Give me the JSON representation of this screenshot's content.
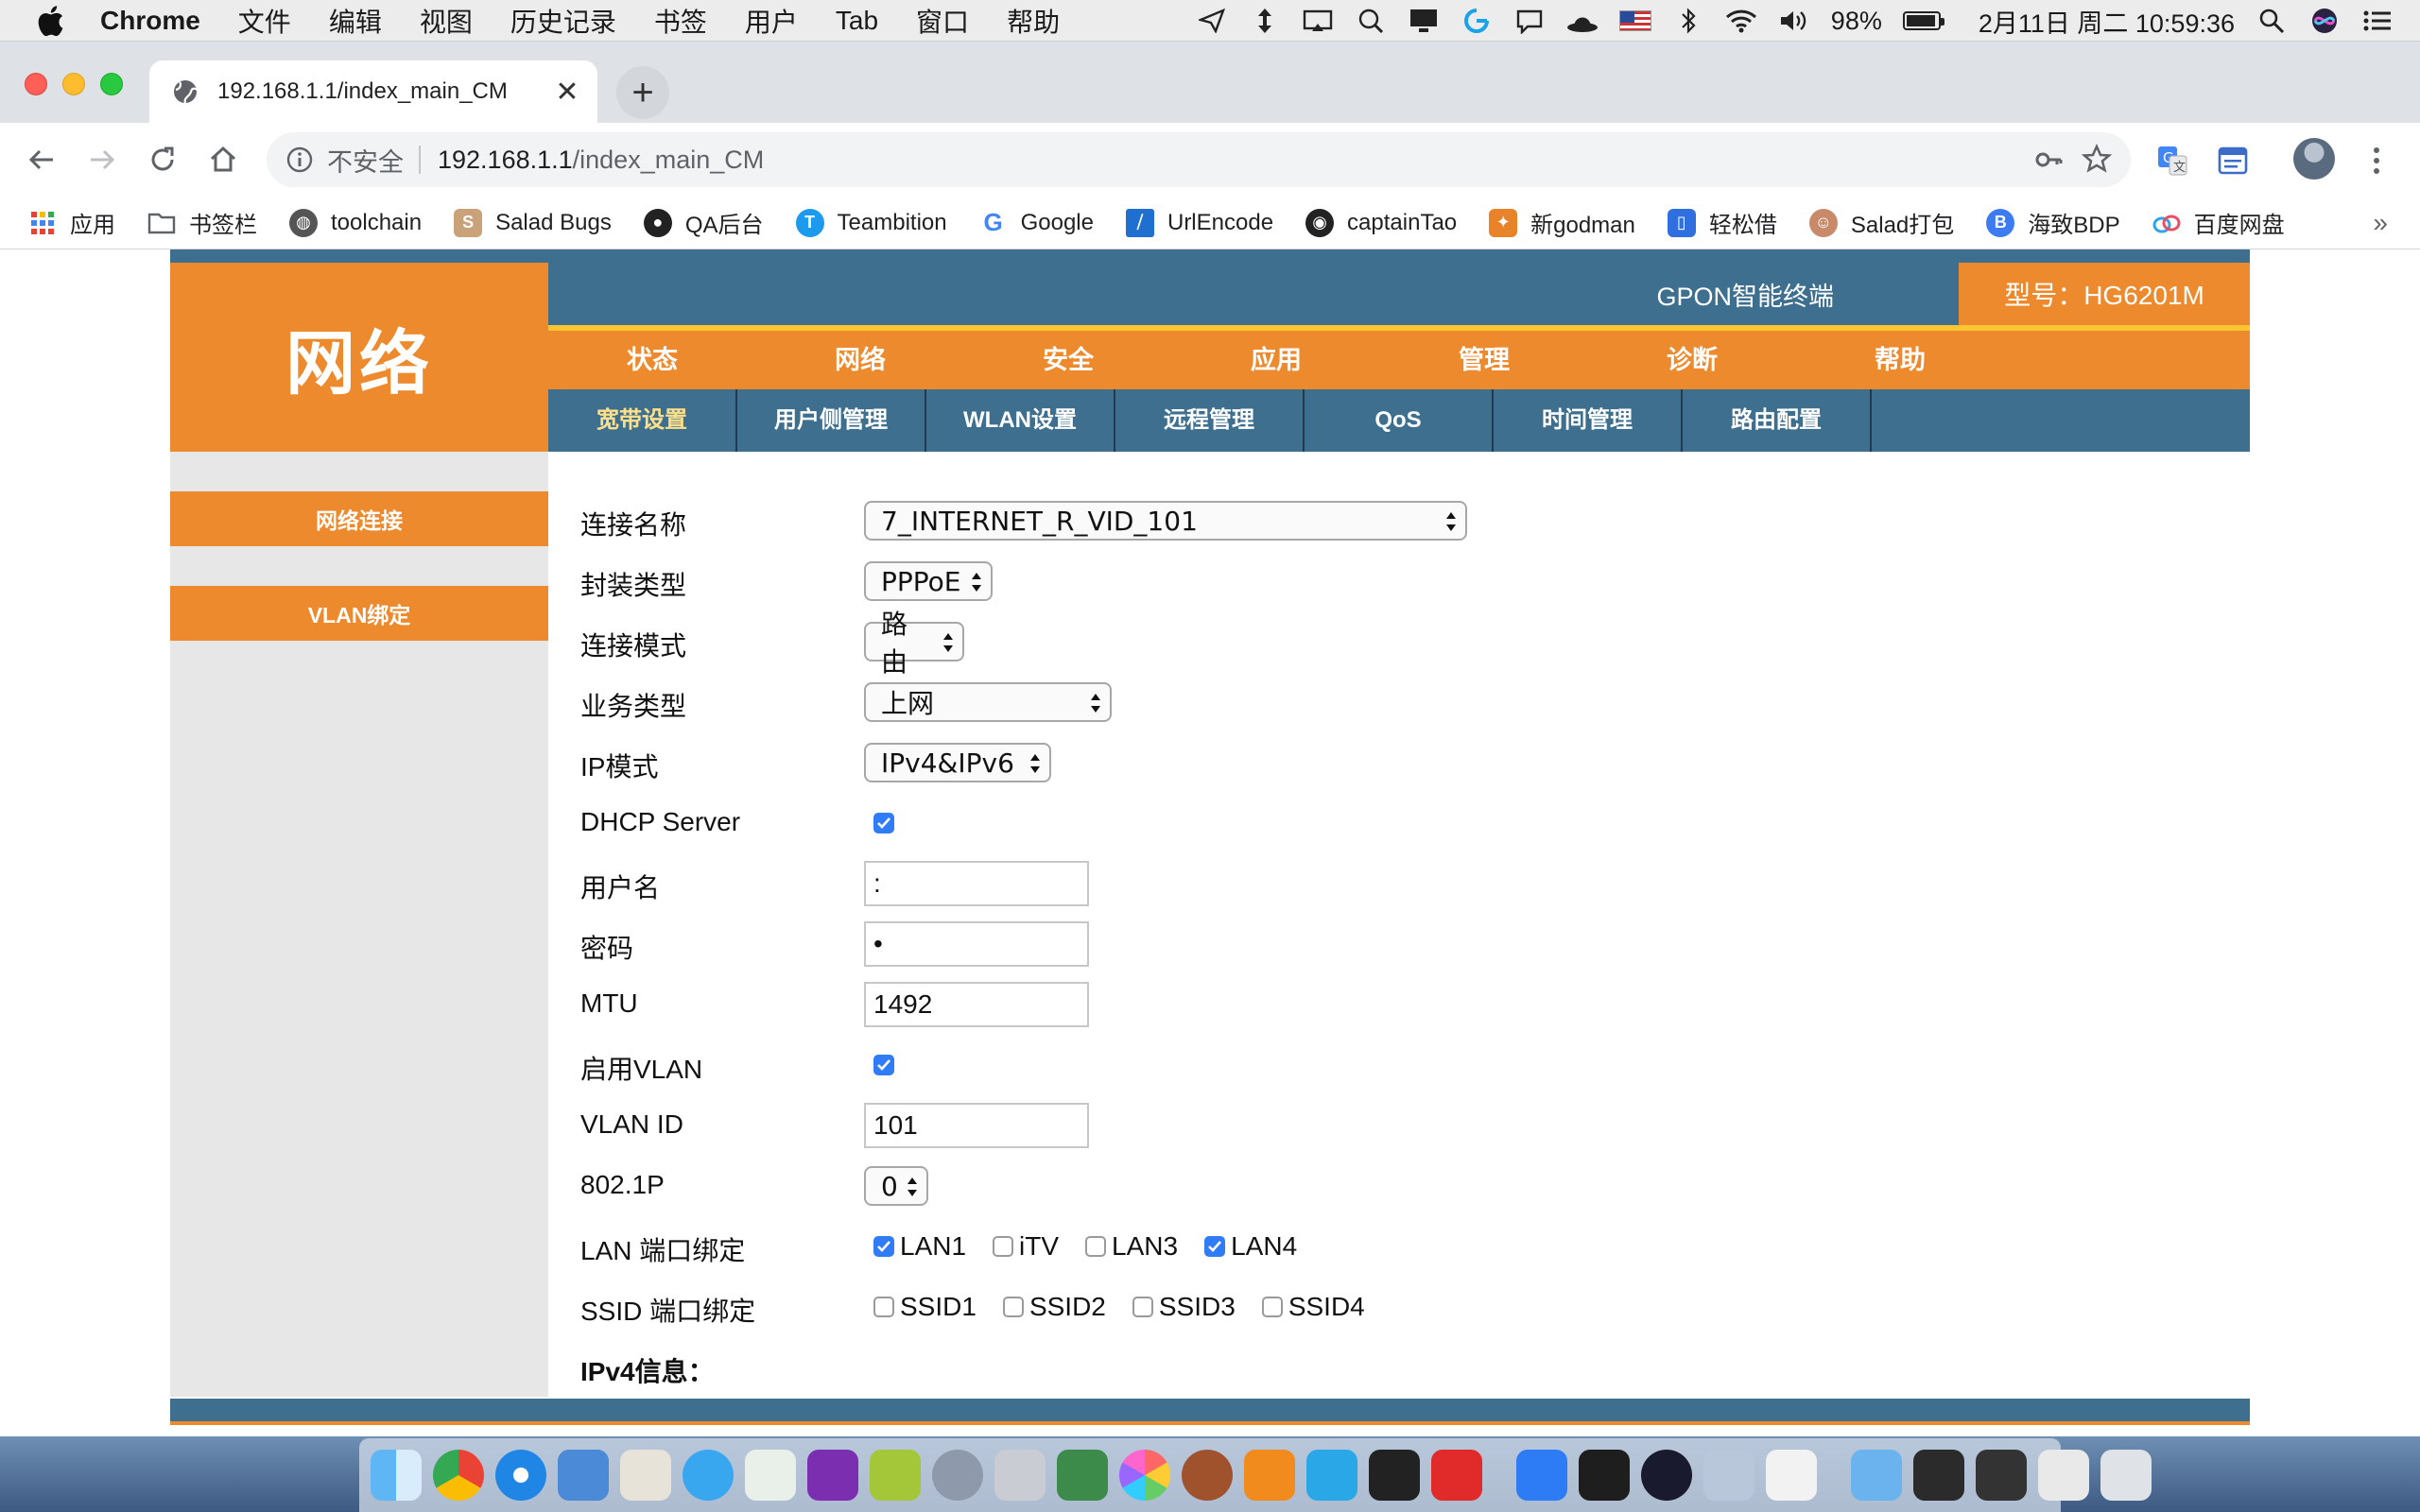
{
  "menubar": {
    "items": [
      "Chrome",
      "文件",
      "编辑",
      "视图",
      "历史记录",
      "书签",
      "用户",
      "Tab",
      "窗口",
      "帮助"
    ],
    "battery": "98%",
    "datetime": "2月11日 周二  10:59:36"
  },
  "browser": {
    "tab_title": "192.168.1.1/index_main_CM",
    "new_tab_label": "+",
    "security_label": "不安全",
    "url_host": "192.168.1.1",
    "url_path": "/index_main_CM"
  },
  "bookmarks": [
    {
      "label": "应用",
      "icon": "apps-grid-icon",
      "color": "#e44"
    },
    {
      "label": "书签栏",
      "icon": "folder-icon",
      "color": "#777"
    },
    {
      "label": "toolchain",
      "icon": "globe-icon",
      "color": "#555"
    },
    {
      "label": "Salad Bugs",
      "icon": "salad-icon",
      "color": "#a86"
    },
    {
      "label": "QA后台",
      "icon": "qa-icon",
      "color": "#222"
    },
    {
      "label": "Teambition",
      "icon": "teambition-icon",
      "color": "#1b9aee"
    },
    {
      "label": "Google",
      "icon": "google-icon",
      "color": "#4285f4"
    },
    {
      "label": "UrlEncode",
      "icon": "urlencode-icon",
      "color": "#1e6fd0"
    },
    {
      "label": "captainTao",
      "icon": "github-icon",
      "color": "#222"
    },
    {
      "label": "新godman",
      "icon": "godman-icon",
      "color": "#e8832a"
    },
    {
      "label": "轻松借",
      "icon": "phone-icon",
      "color": "#2f6fe0"
    },
    {
      "label": "Salad打包",
      "icon": "avatar-icon",
      "color": "#b57"
    },
    {
      "label": "海致BDP",
      "icon": "bdp-icon",
      "color": "#3d7cf0"
    },
    {
      "label": "百度网盘",
      "icon": "baidu-pan-icon",
      "color": "#2fa4e7"
    }
  ],
  "router": {
    "section_title": "网络",
    "product_name": "GPON智能终端",
    "model_label": "型号：HG6201M",
    "main_nav": [
      "状态",
      "网络",
      "安全",
      "应用",
      "管理",
      "诊断",
      "帮助"
    ],
    "sub_nav": [
      "宽带设置",
      "用户侧管理",
      "WLAN设置",
      "远程管理",
      "QoS",
      "时间管理",
      "路由配置"
    ],
    "side_nav": [
      "网络连接",
      "VLAN绑定"
    ],
    "form": {
      "connection_name": {
        "label": "连接名称",
        "value": "7_INTERNET_R_VID_101"
      },
      "encap_type": {
        "label": "封装类型",
        "value": "PPPoE"
      },
      "conn_mode": {
        "label": "连接模式",
        "value": "路由"
      },
      "service_type": {
        "label": "业务类型",
        "value": "上网"
      },
      "ip_mode": {
        "label": "IP模式",
        "value": "IPv4&IPv6"
      },
      "dhcp_server": {
        "label": "DHCP Server",
        "checked": true
      },
      "username": {
        "label": "用户名",
        "value": ":"
      },
      "password": {
        "label": "密码",
        "value": "•"
      },
      "mtu": {
        "label": "MTU",
        "value": "1492"
      },
      "enable_vlan": {
        "label": "启用VLAN",
        "checked": true
      },
      "vlan_id": {
        "label": "VLAN ID",
        "value": "101"
      },
      "priority": {
        "label": "802.1P",
        "value": "0"
      },
      "lan_binding": {
        "label": "LAN 端口绑定",
        "ports": [
          {
            "name": "LAN1",
            "checked": true
          },
          {
            "name": "iTV",
            "checked": false
          },
          {
            "name": "LAN3",
            "checked": false
          },
          {
            "name": "LAN4",
            "checked": true
          }
        ]
      },
      "ssid_binding": {
        "label": "SSID 端口绑定",
        "ports": [
          {
            "name": "SSID1",
            "checked": false
          },
          {
            "name": "SSID2",
            "checked": false
          },
          {
            "name": "SSID3",
            "checked": false
          },
          {
            "name": "SSID4",
            "checked": false
          }
        ]
      },
      "ipv4_info_title": "IPv4信息："
    }
  },
  "colors": {
    "orange": "#ee8a2e",
    "steel_blue": "#3f6f8f",
    "yellow_accent": "#f9c531",
    "checkbox_blue": "#2f7cf6"
  }
}
